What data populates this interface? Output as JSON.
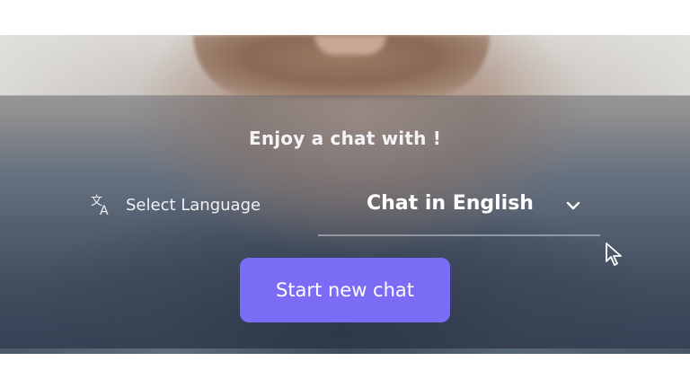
{
  "panel": {
    "heading": "Enjoy a chat with !",
    "language_label": "Select Language",
    "language_select": {
      "selected": "Chat in English"
    },
    "start_button": "Start new chat"
  },
  "icons": {
    "translate": "translate-icon",
    "chevron": "chevron-down-icon",
    "cursor": "mouse-pointer-icon"
  },
  "colors": {
    "primary_button": "#7b6cf6",
    "text": "#ffffff"
  }
}
